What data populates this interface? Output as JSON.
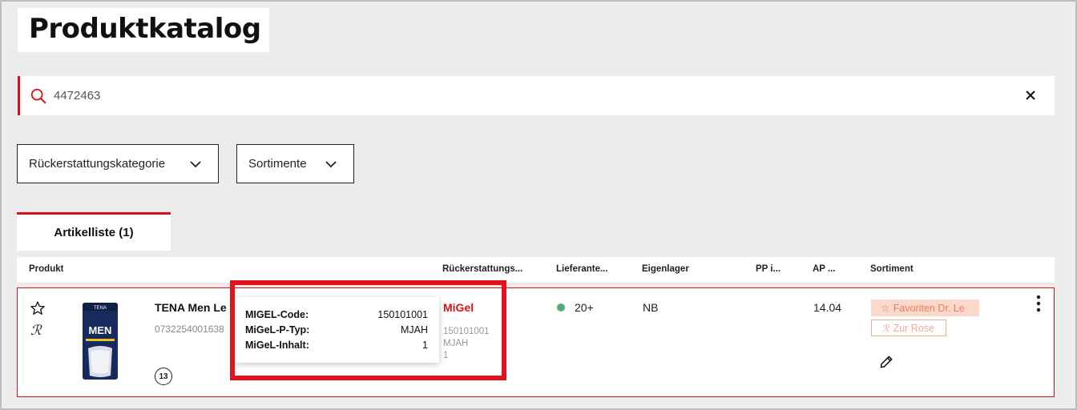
{
  "page": {
    "title": "Produktkatalog"
  },
  "search": {
    "value": "4472463",
    "placeholder": ""
  },
  "filters": [
    {
      "label": "Rückerstattungskategorie"
    },
    {
      "label": "Sortimente"
    }
  ],
  "tabs": [
    {
      "label": "Artikelliste (1)",
      "active": true
    }
  ],
  "table": {
    "headers": [
      "Produkt",
      "Rückerstattungs...",
      "Lieferante...",
      "Eigenlager",
      "PP i...",
      "AP ...",
      "Sortiment"
    ],
    "rows": [
      {
        "name": "TENA Men Le",
        "code": "0732254001638",
        "image_icon": "tena-men-package-icon",
        "variants_count": "13",
        "reimbursement": {
          "label": "MiGel",
          "code": "150101001",
          "type": "MJAH",
          "content": "1"
        },
        "supplier": {
          "status_color": "#4caf7a",
          "value": "20+"
        },
        "own_stock": "NB",
        "pp": "",
        "ap": "14.04",
        "assortments": [
          {
            "label": "Favoriten Dr. Le",
            "icon": "star-outline-icon"
          },
          {
            "label": "Zur Rose",
            "icon": "rx-icon"
          }
        ]
      }
    ]
  },
  "tooltip": {
    "rows": [
      {
        "key": "MIGEL-Code:",
        "value": "150101001"
      },
      {
        "key": "MiGeL-P-Typ:",
        "value": "MJAH"
      },
      {
        "key": "MiGeL-Inhalt:",
        "value": "1"
      }
    ]
  },
  "colors": {
    "accent": "#d5121c",
    "highlight": "#e3121c",
    "tag_fav_bg": "#fbd8cc",
    "tag_fav_fg": "#f07a52",
    "status_green": "#4caf7a"
  }
}
